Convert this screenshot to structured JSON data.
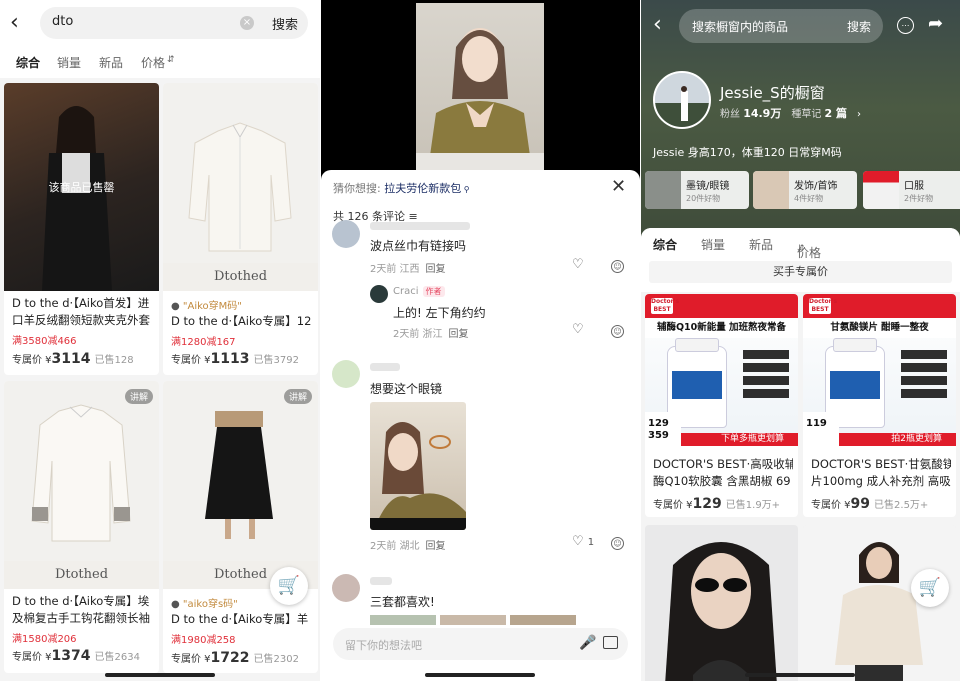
{
  "panel1": {
    "search_query": "dto",
    "search_button": "搜索",
    "filters": [
      "综合",
      "销量",
      "新品",
      "价格"
    ],
    "products": [
      {
        "title": "D to the d·【Aiko首发】进",
        "title2": "口羊反绒翻领短款夹克外套",
        "discount": "满3580减466",
        "price_label": "专属价 ¥",
        "price": "3114",
        "sold": "已售128",
        "overlay": "该商品已售罄"
      },
      {
        "brand": "Dtothed",
        "tag": "\"Aiko穿M码\"",
        "title": "D to the d·【Aiko专属】12",
        "discount": "满1280减167",
        "price_label": "专属价 ¥",
        "price": "1113",
        "sold": "已售3792"
      },
      {
        "brand": "Dtothed",
        "explain": "讲解",
        "title": "D to the d·【Aiko专属】埃",
        "title2": "及棉复古手工钩花翻领长袖",
        "discount": "满1580减206",
        "price_label": "专属价 ¥",
        "price": "1374",
        "sold": "已售2634"
      },
      {
        "brand": "Dtothed",
        "explain": "讲解",
        "tag": "\"aiko穿s码\"",
        "title": "D to the d·【Aiko专属】羊",
        "discount": "满1980减258",
        "price_label": "专属价 ¥",
        "price": "1722",
        "sold": "已售2302"
      }
    ]
  },
  "panel2": {
    "guess_label": "猜你想搜:",
    "guess_query": "拉夫劳伦新款包",
    "comment_count": "共 126 条评论",
    "comments": [
      {
        "text": "波点丝巾有链接吗",
        "meta": "2天前 江西",
        "reply": "回复"
      },
      {
        "name": "Craci",
        "author_badge": "作者",
        "text": "上的! 左下角约约",
        "meta": "2天前 浙江",
        "reply": "回复"
      },
      {
        "text": "想要这个眼镜",
        "meta": "2天前 湖北",
        "reply": "回复",
        "likes": "1"
      },
      {
        "text": "三套都喜欢!"
      }
    ],
    "input_placeholder": "留下你的想法吧"
  },
  "panel3": {
    "search_placeholder": "搜索橱窗内的商品",
    "search_button": "搜索",
    "shop_name": "Jessie_S的橱窗",
    "fans_label": "粉丝",
    "fans": "14.9万",
    "notes_label": "種草记",
    "notes": "2 篇",
    "bio": "Jessie 身高170，体重120 日常穿M码",
    "categories": [
      {
        "name": "墨镜/眼镜",
        "count": "20件好物"
      },
      {
        "name": "发饰/首饰",
        "count": "4件好物"
      },
      {
        "name": "口服",
        "count": "2件好物"
      }
    ],
    "tabs": [
      "综合",
      "销量",
      "新品",
      "价格"
    ],
    "exclusive": "买手专属价",
    "products": [
      {
        "headline": "辅酶Q10新能量 加班熬夜常备",
        "promo_big": "129",
        "promo_small": "359",
        "banner": "下单多瓶更划算",
        "title": "DOCTOR'S BEST·高吸收辅",
        "title2": "酶Q10软胶囊 含黑胡椒 69",
        "price_label": "专属价 ¥",
        "price": "129",
        "sold": "已售1.9万+"
      },
      {
        "headline": "甘氨酸镁片 酣睡一整夜",
        "promo_big": "119",
        "banner": "拍2瓶更划算",
        "title": "DOCTOR'S BEST·甘氨酸镁",
        "title2": "片100mg 成人补充剂 高吸",
        "price_label": "专属价 ¥",
        "price": "99",
        "sold": "已售2.5万+"
      }
    ]
  }
}
